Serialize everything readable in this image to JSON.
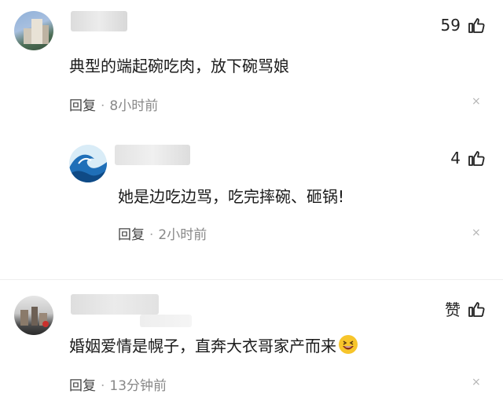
{
  "comments": [
    {
      "text": "典型的端起碗吃肉，放下碗骂娘",
      "reply_label": "回复",
      "time": "8小时前",
      "likes": "59",
      "close": "×"
    },
    {
      "text": "她是边吃边骂，吃完摔碗、砸锅!",
      "reply_label": "回复",
      "time": "2小时前",
      "likes": "4",
      "close": "×"
    },
    {
      "text": "婚姻爱情是幌子，直奔大衣哥家产而来",
      "reply_label": "回复",
      "time": "13分钟前",
      "likes": "赞",
      "close": "×"
    }
  ],
  "separator": "·",
  "icons": {
    "like": "thumbs-up-icon",
    "emoji": "grinning-face-icon",
    "close": "close-icon"
  },
  "colors": {
    "text": "#1a1a1a",
    "meta": "#888888",
    "close": "#b5b5b5"
  }
}
